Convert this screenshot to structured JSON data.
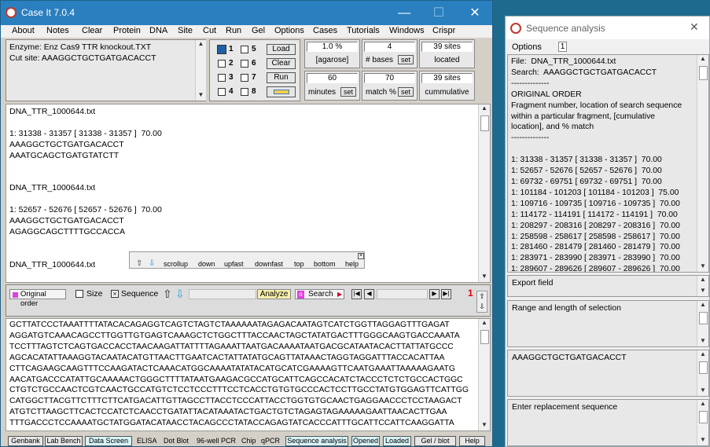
{
  "app": {
    "title": "Case It 7.0.4",
    "menu": [
      "About",
      "Notes",
      "Clear",
      "Protein",
      "DNA",
      "Site",
      "Cut",
      "Run",
      "Gel",
      "Options",
      "Cases",
      "Tutorials",
      "Windows",
      "Crispr"
    ]
  },
  "info_box": {
    "enzyme_line": "Enzyme: Enz Cas9 TTR knockout.TXT",
    "cutsite_line": "Cut site: AAAGGCTGCTGATGACACCT"
  },
  "lanes": [
    "1",
    "5",
    "2",
    "6",
    "3",
    "7",
    "4",
    "8"
  ],
  "lane_buttons": {
    "load": "Load",
    "clear": "Clear",
    "run": "Run"
  },
  "params": {
    "agarose_value": "1.0 %",
    "agarose_label": "[agarose]",
    "bases_value": "4",
    "bases_label": "# bases",
    "set": "set",
    "sites_value": "39 sites",
    "located_label": "located",
    "minutes_value": "60",
    "minutes_label": "minutes",
    "match_value": "70",
    "match_label": "match %",
    "sites2_value": "39 sites",
    "cumulative_label": "cummulative"
  },
  "results": {
    "text": "DNA_TTR_1000644.txt\n\n1: 31338 - 31357 [ 31338 - 31357 ]  70.00\nAAAGGCTGCTGATGACACCT\nAAATGCAGCTGATGTATCTT\n\n\nDNA_TTR_1000644.txt\n\n1: 52657 - 52676 [ 52657 - 52676 ]  70.00\nAAAGGCTGCTGATGACACCT\nAGAGGCAGCTTTTGCCACCA\n\n\nDNA_TTR_1000644.txt"
  },
  "scroll_popup": {
    "items": [
      "scrollup",
      "down",
      "upfast",
      "downfast",
      "top",
      "bottom",
      "help"
    ]
  },
  "toolbar": {
    "original_order": "Original order",
    "size": "Size",
    "sequence": "Sequence",
    "analyze": "Analyze",
    "search": "Search",
    "page_number": "1"
  },
  "sequence_text": "GCTTATCCCTAAATTTTATACACAGAGGTCAGTCTAGTCTAAAAAATAGAGACAATAGTCATCTGGTTAGGAGTTTGAGAT\nAGGATGTCAAACAGCCTTGGTTGTGAGTCAAAGCTCTGGCTTTACCAACTAGCTATATGACTTTGGGCAAGTGACCAAATA\nTCCTTTAGTCTCAGTGACCACCTAACAAGATTATTTTAGAAATTAATGACAAAATAATGACGCATAATACACTTATTATGCCC\nAGCACATATTAAAGGTACAATACATGTTAACTTGAATCACTATTATATGCAGTTATAAACTAGGTAGGATTTACCACATTAA\nCTTCAGAAGCAAGTTTCCAAGATACTCAAACATGGCAAAATATATACATGCATCGAAAAGTTCAATGAAATTAAAAAGAATG\nAACATGACCCATATTGCAAAAACTGGGCTTTTATAATGAAGACGCCATGCATTCAGCCACATCTACCCTCTCTGCCACTGGC\nCTGTCTGCCAACTCGTCAACTGCCATGTCTCCTCCCTTTCCTCACCTGTGTGCCCACTCCTTGCCTATGTGGAGTTCATTGG\nCATGGCTTACGTTCTTTCTTCATGACATTGTTAGCCTTACCTCCCATTACCTGGTGTGCAACTGAGGAACCCTCCTAAGACT\nATGTCTTAAGCTTCACTCCATCTCAACCTGATATTACATAAATACTGACTGTCTAGAGTAGAAAAAGAATTAACACTTGAA\nTTTGACCCTCCAAAATGCTATGGATACATAACCTACAGCCCTATACCAGAGTATCACCCATTTGCATTCCATTCAAGGATTA",
  "tabs": [
    "Genbank",
    "Lab Bench",
    "Data Screen",
    "ELISA",
    "Dot Blot",
    "96-well PCR",
    "Chip",
    "qPCR",
    "Sequence analysis",
    "Opened",
    "Loaded",
    "Gel / blot",
    "Help"
  ],
  "seq_window": {
    "title": "Sequence analysis",
    "options_label": "Options",
    "options_value": "1",
    "text": "File:  DNA_TTR_1000644.txt\nSearch:  AAAGGCTGCTGATGACACCT\n--------------\nORIGINAL ORDER\nFragment number, location of search sequence\nwithin a particular fragment, [cumulative\nlocation], and % match\n--------------\n\n1: 31338 - 31357 [ 31338 - 31357 ]  70.00\n1: 52657 - 52676 [ 52657 - 52676 ]  70.00\n1: 69732 - 69751 [ 69732 - 69751 ]  70.00\n1: 101184 - 101203 [ 101184 - 101203 ]  75.00\n1: 109716 - 109735 [ 109716 - 109735 ]  70.00\n1: 114172 - 114191 [ 114172 - 114191 ]  70.00\n1: 208297 - 208316 [ 208297 - 208316 ]  70.00\n1: 258598 - 258617 [ 258598 - 258617 ]  70.00\n1: 281460 - 281479 [ 281460 - 281479 ]  70.00\n1: 283971 - 283990 [ 283971 - 283990 ]  70.00\n1: 289607 - 289626 [ 289607 - 289626 ]  70.00",
    "export_label": "Export field",
    "range_label": "Range and length of selection",
    "search_seq": "AAAGGCTGCTGATGACACCT",
    "replacement_label": "Enter replacement sequence"
  }
}
